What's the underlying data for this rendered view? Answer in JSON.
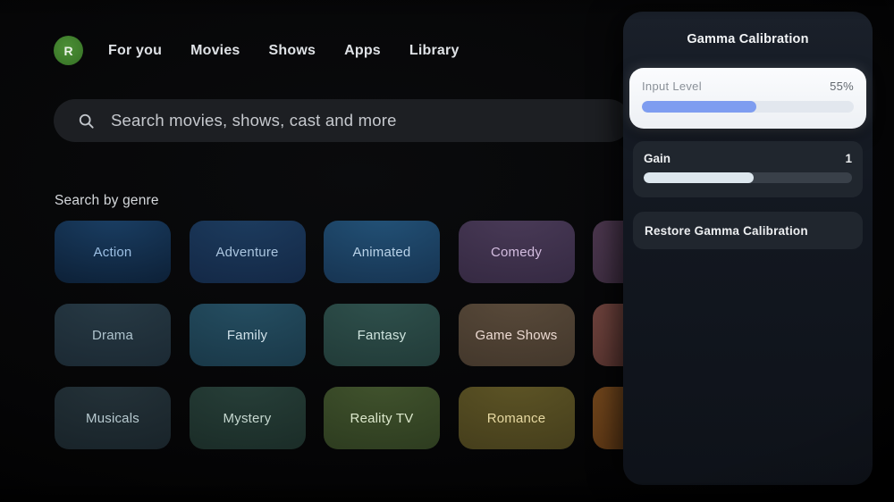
{
  "nav": {
    "avatar_letter": "R",
    "items": [
      {
        "label": "For you"
      },
      {
        "label": "Movies"
      },
      {
        "label": "Shows"
      },
      {
        "label": "Apps"
      },
      {
        "label": "Library"
      }
    ]
  },
  "search": {
    "placeholder": "Search movies, shows, cast and more"
  },
  "genres": {
    "section_title": "Search by genre",
    "items": [
      {
        "label": "Action",
        "color_center": "#1b4066",
        "color_edge": "#0d2138",
        "text_color": "#9dc0e4"
      },
      {
        "label": "Adventure",
        "color_center": "#1d3d60",
        "color_edge": "#142947",
        "text_color": "#abc5df"
      },
      {
        "label": "Animated",
        "color_center": "#235379",
        "color_edge": "#173553",
        "text_color": "#b9d2e8"
      },
      {
        "label": "Comedy",
        "color_center": "#4a3b58",
        "color_edge": "#362a43",
        "text_color": "#d3bcdf"
      },
      {
        "label": "",
        "color_center": "#523c55",
        "color_edge": "#423045",
        "text_color": "#d8c4de"
      },
      {
        "label": "Drama",
        "color_center": "#283b46",
        "color_edge": "#1c2a34",
        "text_color": "#aec3cd"
      },
      {
        "label": "Family",
        "color_center": "#265064",
        "color_edge": "#1a3949",
        "text_color": "#cfe0e8"
      },
      {
        "label": "Fantasy",
        "color_center": "#30524e",
        "color_edge": "#223c39",
        "text_color": "#cfe4de"
      },
      {
        "label": "Game Shows",
        "color_center": "#5a4b3b",
        "color_edge": "#44382c",
        "text_color": "#ecdad2"
      },
      {
        "label": "",
        "color_center": "#7a4a44",
        "color_edge": "#5e3833",
        "text_color": "#e8c8c0"
      },
      {
        "label": "Musicals",
        "color_center": "#25333a",
        "color_edge": "#19242a",
        "text_color": "#b8cad0"
      },
      {
        "label": "Mystery",
        "color_center": "#28403a",
        "color_edge": "#1b2d28",
        "text_color": "#c6d8d0"
      },
      {
        "label": "Reality TV",
        "color_center": "#42542e",
        "color_edge": "#2e3d20",
        "text_color": "#dce8cc"
      },
      {
        "label": "Romance",
        "color_center": "#5e5526",
        "color_edge": "#463f1c",
        "text_color": "#e7d9a2"
      },
      {
        "label": "",
        "color_center": "#7b4d20",
        "color_edge": "#613a16",
        "text_color": "#ecd2b0"
      }
    ]
  },
  "panel": {
    "title": "Gamma Calibration",
    "controls": [
      {
        "label": "Input Level",
        "value": "55%",
        "fill_percent": 54,
        "fill_color": "#7e9df0",
        "focused": true
      },
      {
        "label": "Gain",
        "value": "1",
        "fill_percent": 53,
        "fill_color": "#dde7ee",
        "focused": false
      }
    ],
    "restore_label": "Restore Gamma Calibration"
  },
  "colors": {
    "accent_slider_blue": "#7e9df0",
    "avatar_green": "#3c7a2a",
    "panel_bg": "#131821",
    "focused_card_bg": "#f5f7fa"
  }
}
